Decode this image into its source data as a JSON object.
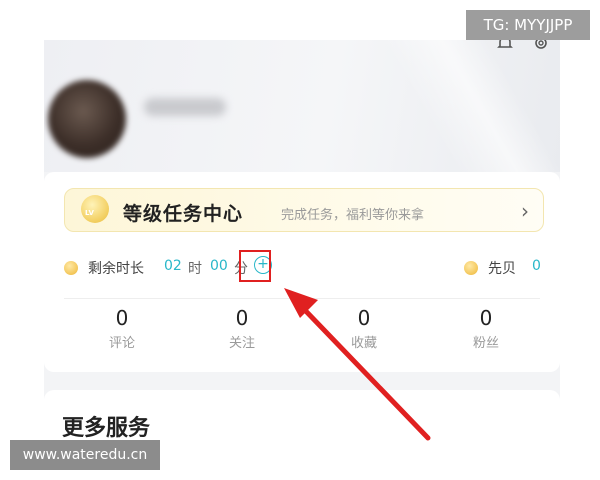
{
  "profile": {
    "avatar_icon": "avatar-blurred",
    "name": ""
  },
  "top_icons": [
    "bell-icon",
    "gear-icon"
  ],
  "task_center": {
    "badge_text": "LV",
    "title": "等级任务中心",
    "subtitle": "完成任务，福利等你来拿",
    "chevron": "›"
  },
  "remaining_time": {
    "label": "剩余时长",
    "hours": "02",
    "hours_unit": "时",
    "minutes": "00",
    "minutes_unit": "分",
    "add_symbol": "+"
  },
  "xianbei": {
    "label": "先贝",
    "value": "0"
  },
  "stats": [
    {
      "value": "0",
      "label": "评论"
    },
    {
      "value": "0",
      "label": "关注"
    },
    {
      "value": "0",
      "label": "收藏"
    },
    {
      "value": "0",
      "label": "粉丝"
    }
  ],
  "services": {
    "title": "更多服务"
  },
  "annotation": {
    "color": "#e02020",
    "shape": "arrow-pointing-to-add-button"
  },
  "watermarks": {
    "top_right": "TG: MYYJJPP",
    "bottom_left": "www.wateredu.cn"
  },
  "colors": {
    "accent": "#28b7c9",
    "highlight": "#e02020",
    "banner_bg": "#fdf6d8"
  }
}
